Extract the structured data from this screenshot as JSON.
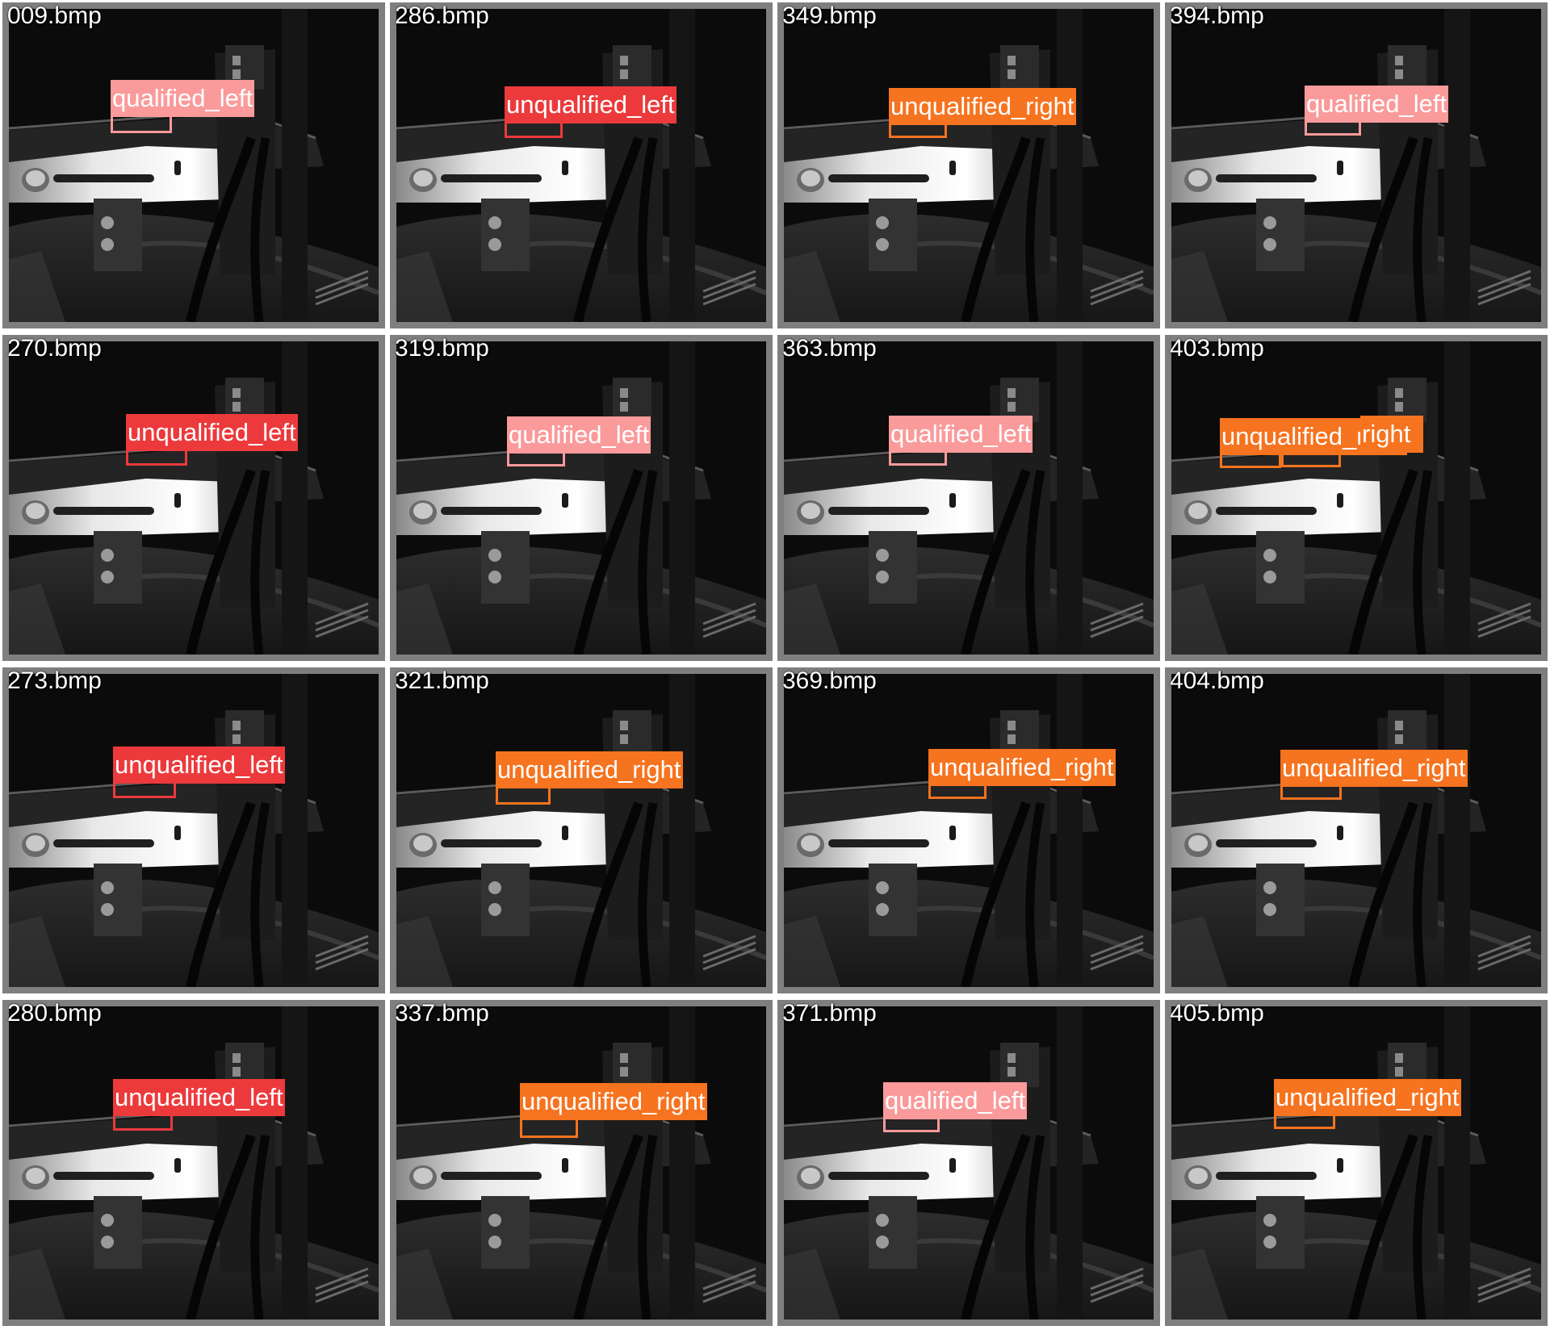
{
  "colors": {
    "qualified_left": "#fa9a9a",
    "unqualified_left": "#ec3a3c",
    "unqualified_right": "#f6731f"
  },
  "tiles": [
    {
      "filename": "009.bmp",
      "detections": [
        {
          "label": "qualified_left",
          "class": "qualified_left"
        }
      ]
    },
    {
      "filename": "286.bmp",
      "detections": [
        {
          "label": "unqualified_left",
          "class": "unqualified_left"
        }
      ]
    },
    {
      "filename": "349.bmp",
      "detections": [
        {
          "label": "unqualified_right",
          "class": "unqualified_right"
        }
      ]
    },
    {
      "filename": "394.bmp",
      "detections": [
        {
          "label": "qualified_left",
          "class": "qualified_left"
        }
      ]
    },
    {
      "filename": "270.bmp",
      "detections": [
        {
          "label": "unqualified_left",
          "class": "unqualified_left"
        }
      ]
    },
    {
      "filename": "319.bmp",
      "detections": [
        {
          "label": "qualified_left",
          "class": "qualified_left"
        }
      ]
    },
    {
      "filename": "363.bmp",
      "detections": [
        {
          "label": "qualified_left",
          "class": "qualified_left"
        }
      ]
    },
    {
      "filename": "403.bmp",
      "detections": [
        {
          "label": "unqualified_right",
          "class": "unqualified_right"
        },
        {
          "label": "right",
          "class": "unqualified_right"
        }
      ]
    },
    {
      "filename": "273.bmp",
      "detections": [
        {
          "label": "unqualified_left",
          "class": "unqualified_left"
        }
      ]
    },
    {
      "filename": "321.bmp",
      "detections": [
        {
          "label": "unqualified_right",
          "class": "unqualified_right"
        }
      ]
    },
    {
      "filename": "369.bmp",
      "detections": [
        {
          "label": "unqualified_right",
          "class": "unqualified_right"
        }
      ]
    },
    {
      "filename": "404.bmp",
      "detections": [
        {
          "label": "unqualified_right",
          "class": "unqualified_right"
        }
      ]
    },
    {
      "filename": "280.bmp",
      "detections": [
        {
          "label": "unqualified_left",
          "class": "unqualified_left"
        }
      ]
    },
    {
      "filename": "337.bmp",
      "detections": [
        {
          "label": "unqualified_right",
          "class": "unqualified_right"
        }
      ]
    },
    {
      "filename": "371.bmp",
      "detections": [
        {
          "label": "qualified_left",
          "class": "qualified_left"
        }
      ]
    },
    {
      "filename": "405.bmp",
      "detections": [
        {
          "label": "unqualified_right",
          "class": "unqualified_right"
        }
      ]
    }
  ]
}
